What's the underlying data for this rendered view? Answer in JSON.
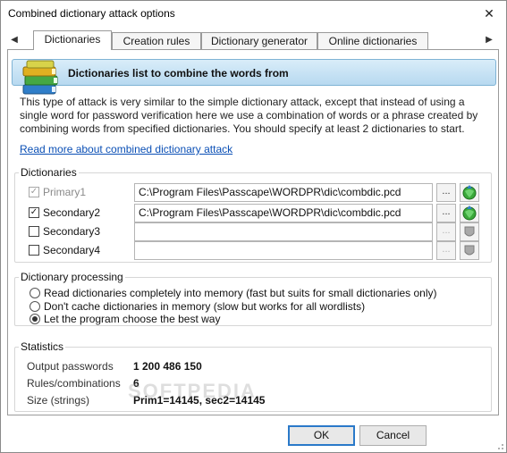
{
  "window": {
    "title": "Combined dictionary attack options"
  },
  "tabs": [
    {
      "label": "Dictionaries",
      "active": true
    },
    {
      "label": "Creation rules",
      "active": false
    },
    {
      "label": "Dictionary generator",
      "active": false
    },
    {
      "label": "Online dictionaries",
      "active": false
    }
  ],
  "banner": {
    "title": "Dictionaries list to combine the words from"
  },
  "description": "This type of attack is very similar to the simple dictionary attack, except that instead of using a single word for password verification here we use a combination of words or a phrase created by combining words from specified dictionaries. You should specify at least 2 dictionaries to start.",
  "read_more_link": "Read more about combined dictionary attack",
  "dictionaries": {
    "legend": "Dictionaries",
    "rows": [
      {
        "label": "Primary1",
        "checked": true,
        "enabled": false,
        "path": "C:\\Program Files\\Passcape\\WORDPR\\dic\\combdic.pcd",
        "browse": "...",
        "status_icon": "globe-green-icon"
      },
      {
        "label": "Secondary2",
        "checked": true,
        "enabled": true,
        "path": "C:\\Program Files\\Passcape\\WORDPR\\dic\\combdic.pcd",
        "browse": "...",
        "status_icon": "globe-green-icon"
      },
      {
        "label": "Secondary3",
        "checked": false,
        "enabled": true,
        "path": "",
        "browse": "...",
        "status_icon": "shield-gray-icon"
      },
      {
        "label": "Secondary4",
        "checked": false,
        "enabled": true,
        "path": "",
        "browse": "...",
        "status_icon": "shield-gray-icon"
      }
    ]
  },
  "processing": {
    "legend": "Dictionary processing",
    "options": [
      {
        "label": "Read dictionaries completely into memory (fast but suits for small dictionaries only)",
        "selected": false
      },
      {
        "label": "Don't cache dictionaries in memory (slow but works for all wordlists)",
        "selected": false
      },
      {
        "label": "Let the program choose the best way",
        "selected": true
      }
    ]
  },
  "statistics": {
    "legend": "Statistics",
    "rows": [
      {
        "label": "Output passwords",
        "value": "1 200 486 150"
      },
      {
        "label": "Rules/combinations",
        "value": "6"
      },
      {
        "label": "Size (strings)",
        "value": "Prim1=14145, sec2=14145"
      }
    ]
  },
  "buttons": {
    "ok": "OK",
    "cancel": "Cancel"
  },
  "watermark": "SOFTPEDIA",
  "colors": {
    "banner": "#c9e4f6",
    "link": "#0a4fb5",
    "default_button_border": "#2a79c9"
  }
}
